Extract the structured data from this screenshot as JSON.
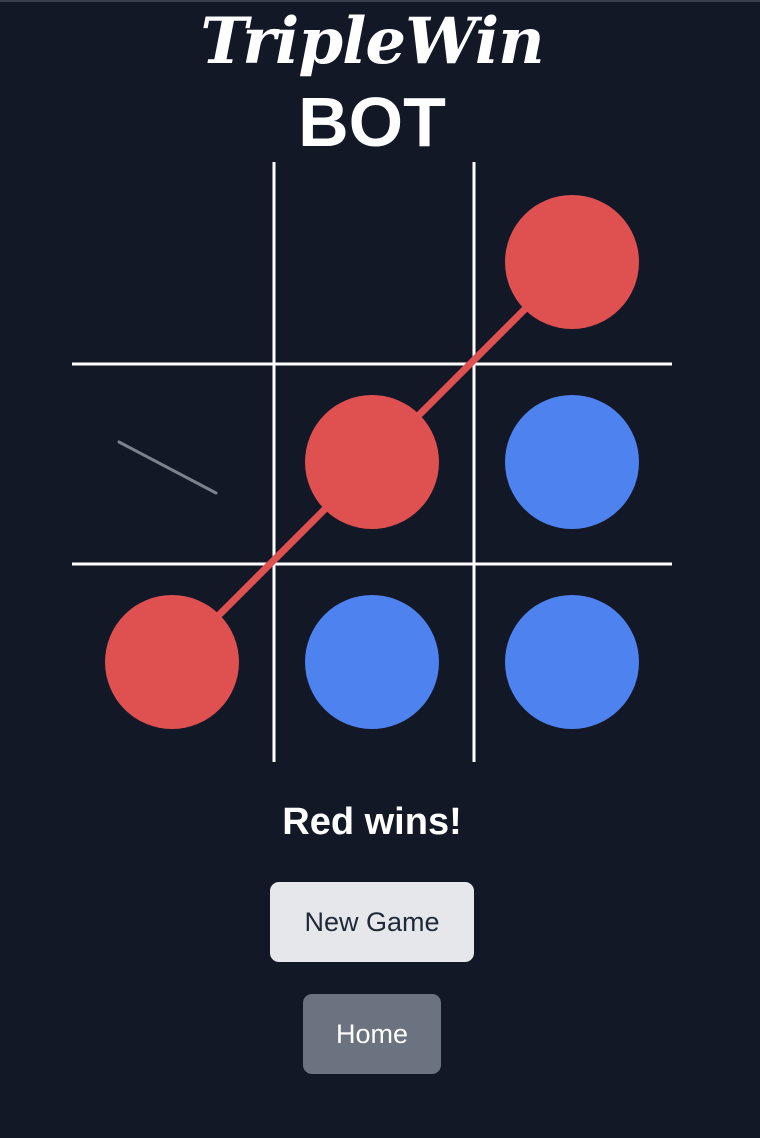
{
  "app": {
    "logo_text": "TripleWin",
    "subtitle": "BOT"
  },
  "board": {
    "cells": [
      "",
      "",
      "red",
      "",
      "red",
      "blue",
      "red",
      "blue",
      "blue"
    ],
    "winning_line": [
      6,
      4,
      2
    ],
    "colors": {
      "red": "#df5150",
      "blue": "#4d82ef",
      "grid": "#ffffff",
      "win_line": "#df5150"
    }
  },
  "status": {
    "message": "Red wins!"
  },
  "buttons": {
    "new_game_label": "New Game",
    "home_label": "Home"
  }
}
